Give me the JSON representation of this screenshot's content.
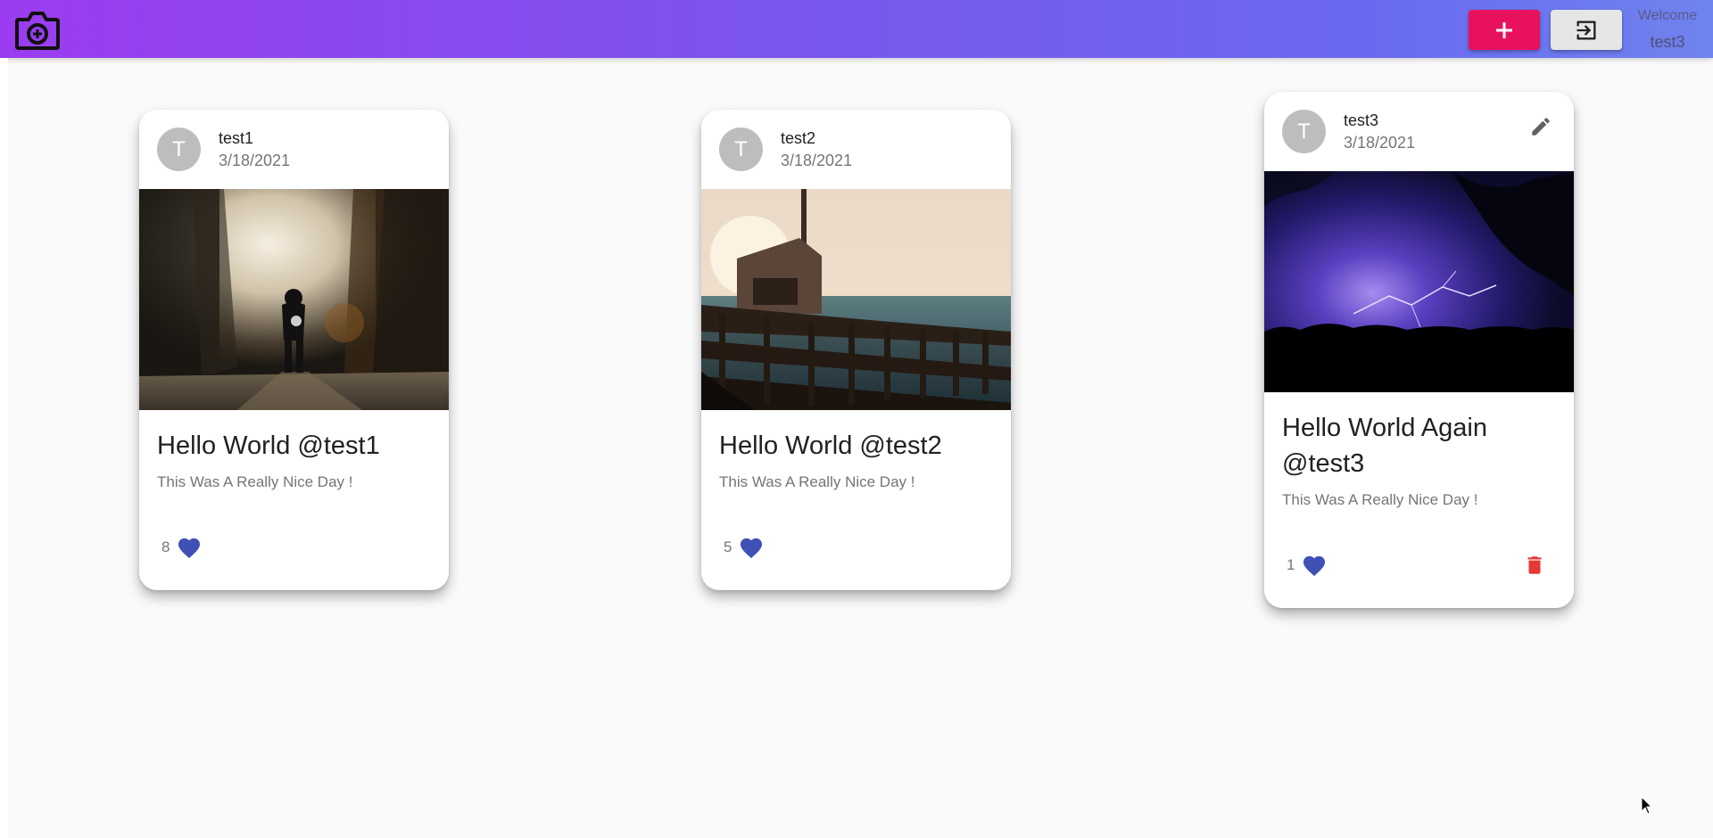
{
  "header": {
    "logo_icon": "camera-add-icon",
    "add_button_icon": "plus-icon",
    "logout_button_icon": "exit-icon",
    "welcome_text": "Welcome",
    "username": "test3",
    "colors": {
      "gradient_start": "#9b3cf0",
      "gradient_end": "#6f83ee",
      "add_button": "#e8115e",
      "logout_button": "#e6e6e6"
    }
  },
  "posts": [
    {
      "avatar_letter": "T",
      "author": "test1",
      "date": "3/18/2021",
      "title": "Hello World @test1",
      "description": "This Was A Really Nice Day !",
      "likes": "8",
      "image_subject": "person walking on a misty forest path"
    },
    {
      "avatar_letter": "T",
      "author": "test2",
      "date": "3/18/2021",
      "title": "Hello World @test2",
      "description": "This Was A Really Nice Day !",
      "likes": "5",
      "image_subject": "pier with railing at sunset by the sea"
    },
    {
      "avatar_letter": "T",
      "author": "test3",
      "date": "3/18/2021",
      "title": "Hello World Again @test3",
      "description": "This Was A Really Nice Day !",
      "likes": "1",
      "image_subject": "purple lightning storm over dark trees",
      "editable": true
    }
  ],
  "icons": {
    "like": "heart-icon",
    "edit": "pencil-icon",
    "delete": "trash-icon"
  },
  "colors": {
    "heart": "#3f51b5",
    "delete": "#e53935",
    "card_bg": "#ffffff",
    "page_bg": "#fafafa"
  }
}
